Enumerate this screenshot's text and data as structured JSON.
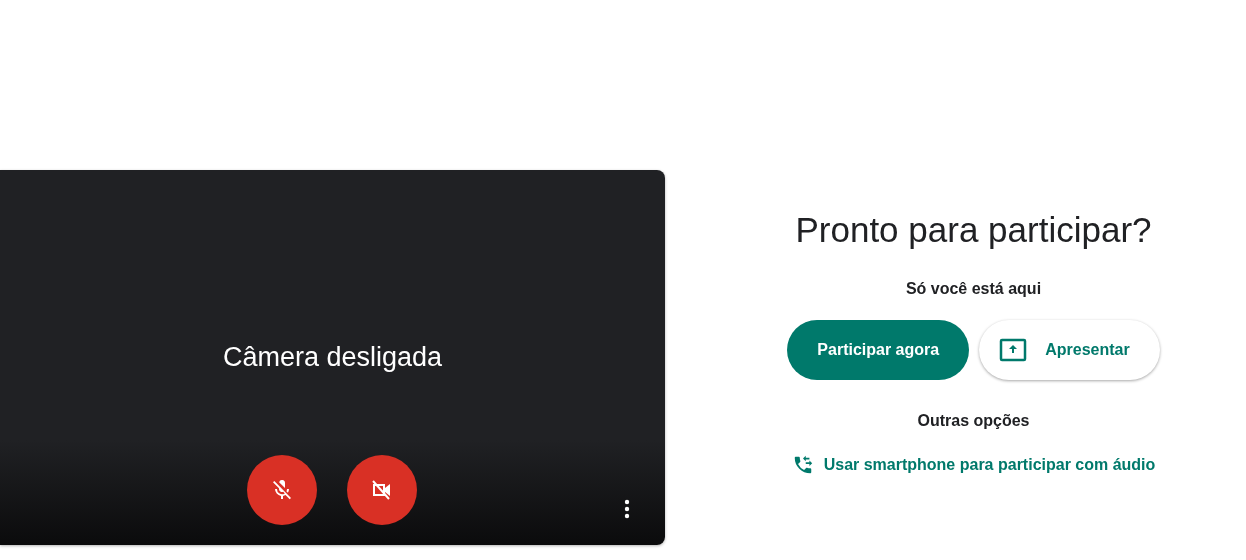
{
  "preview": {
    "message": "Câmera desligada",
    "mic_on": false,
    "camera_on": false
  },
  "join": {
    "title": "Pronto para participar?",
    "status": "Só você está aqui",
    "buttons": [
      {
        "label": "Participar agora",
        "kind": "primary"
      },
      {
        "label": "Apresentar",
        "kind": "present"
      }
    ],
    "other_heading": "Outras opções",
    "phone_link": "Usar smartphone para participar com áudio"
  }
}
